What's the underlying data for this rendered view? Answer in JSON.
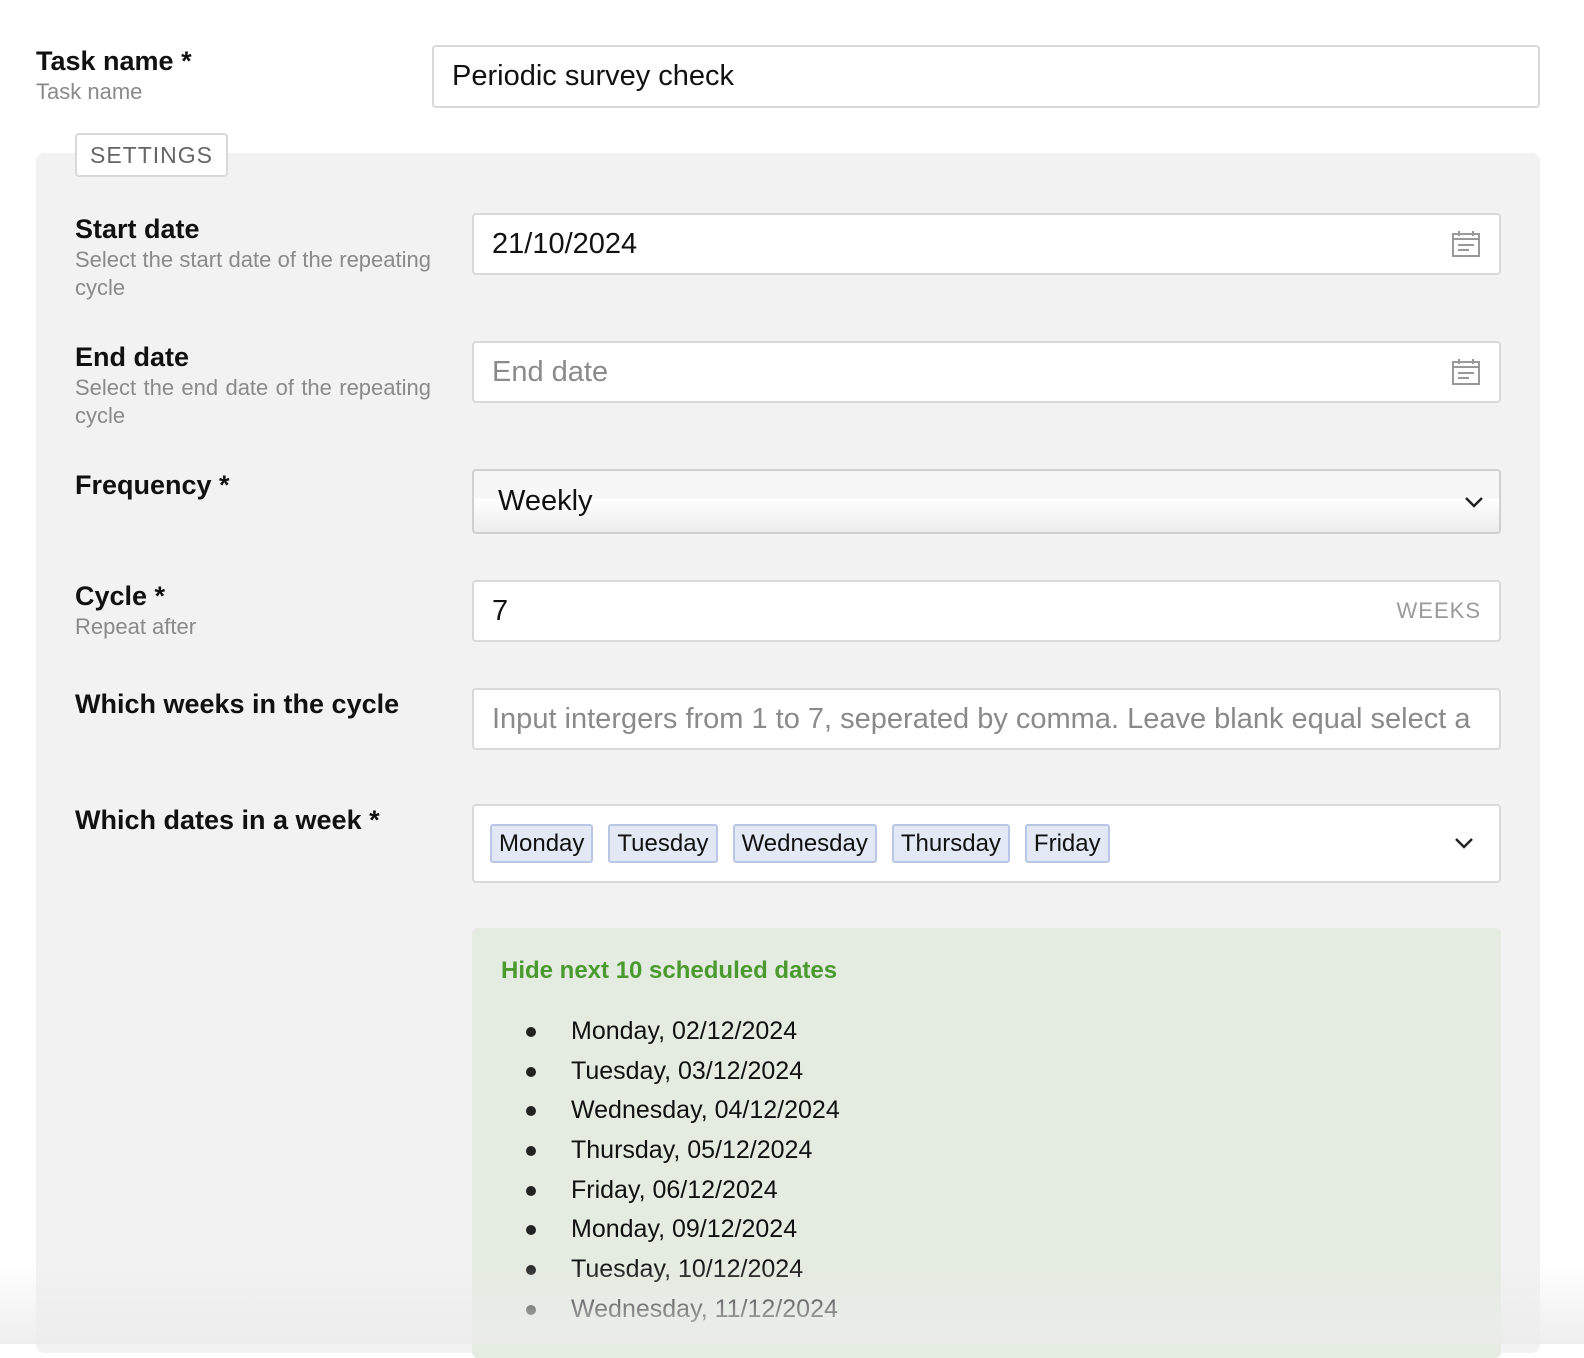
{
  "task": {
    "label": "Task name *",
    "sublabel": "Task name",
    "value": "Periodic survey check"
  },
  "settings": {
    "tab_label": "SETTINGS",
    "start_date": {
      "label": "Start date",
      "description": "Select the start date of the repeating cycle",
      "value": "21/10/2024",
      "icon": "calendar-icon"
    },
    "end_date": {
      "label": "End date",
      "description": "Select the end date of the repeating cycle",
      "placeholder": "End date",
      "icon": "calendar-icon"
    },
    "frequency": {
      "label": "Frequency *",
      "selected": "Weekly",
      "icon": "chevron-down-icon"
    },
    "cycle": {
      "label": "Cycle *",
      "description": "Repeat after",
      "value": "7",
      "unit": "WEEKS"
    },
    "weeks_in_cycle": {
      "label": "Which weeks in the cycle",
      "placeholder": "Input intergers from 1 to 7, seperated by comma. Leave blank equal select a"
    },
    "dates_in_week": {
      "label": "Which dates in a week *",
      "selected": [
        "Monday",
        "Tuesday",
        "Wednesday",
        "Thursday",
        "Friday"
      ],
      "icon": "chevron-down-icon"
    },
    "scheduled": {
      "toggle_label": "Hide next 10 scheduled dates",
      "dates": [
        "Monday, 02/12/2024",
        "Tuesday, 03/12/2024",
        "Wednesday, 04/12/2024",
        "Thursday, 05/12/2024",
        "Friday, 06/12/2024",
        "Monday, 09/12/2024",
        "Tuesday, 10/12/2024",
        "Wednesday, 11/12/2024"
      ]
    }
  },
  "colors": {
    "accent_green": "#4a9a2f",
    "panel_bg": "#f2f2f2",
    "chip_bg": "#e3e8f5",
    "dates_bg": "#e4ebe0"
  }
}
